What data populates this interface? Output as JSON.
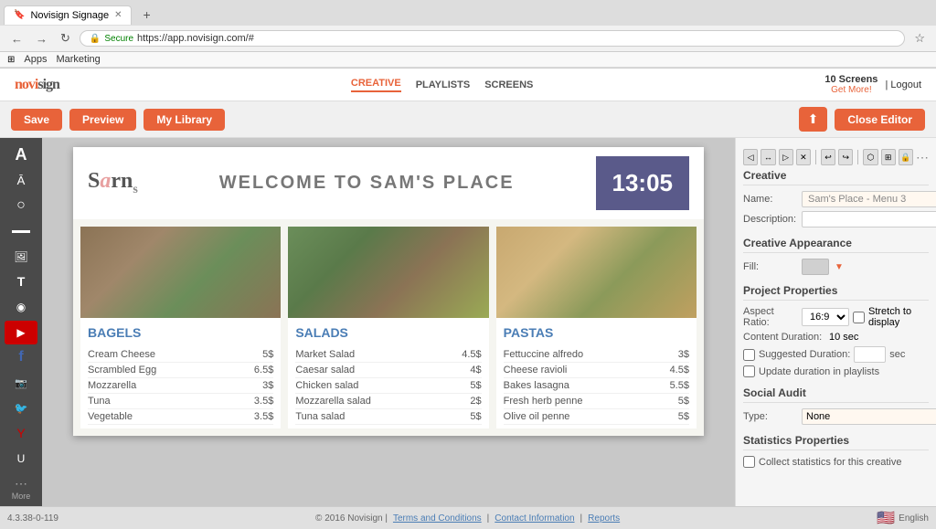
{
  "browser": {
    "tab_title": "Novisign Signage",
    "url": "https://app.novisign.com/#",
    "bookmarks": [
      "Apps",
      "Marketing"
    ]
  },
  "header": {
    "logo": "novi sign",
    "nav": {
      "creative": "CREATIVE",
      "playlists": "PLAYLISTS",
      "screens": "SCREENS"
    },
    "screens_count": "10 Screens",
    "get_more": "Get More!",
    "logout": "| Logout"
  },
  "toolbar": {
    "save": "Save",
    "preview": "Preview",
    "my_library": "My Library",
    "close_editor": "Close Editor"
  },
  "canvas": {
    "sams_logo": "Sams",
    "welcome_text": "WELCOME TO SAM'S PLACE",
    "time": "13:05",
    "sections": [
      {
        "title": "BAGELS",
        "items": [
          {
            "name": "Cream Cheese",
            "price": "5$"
          },
          {
            "name": "Scrambled Egg",
            "price": "6.5$"
          },
          {
            "name": "Mozzarella",
            "price": "3$"
          },
          {
            "name": "Tuna",
            "price": "3.5$"
          },
          {
            "name": "Vegetable",
            "price": "3.5$"
          }
        ]
      },
      {
        "title": "SALADS",
        "items": [
          {
            "name": "Market Salad",
            "price": "4.5$"
          },
          {
            "name": "Caesar salad",
            "price": "4$"
          },
          {
            "name": "Chicken salad",
            "price": "5$"
          },
          {
            "name": "Mozzarella salad",
            "price": "2$"
          },
          {
            "name": "Tuna salad",
            "price": "5$"
          }
        ]
      },
      {
        "title": "PASTAS",
        "items": [
          {
            "name": "Fettuccine alfredo",
            "price": "3$"
          },
          {
            "name": "Cheese ravioli",
            "price": "4.5$"
          },
          {
            "name": "Bakes lasagna",
            "price": "5.5$"
          },
          {
            "name": "Fresh herb penne",
            "price": "5$"
          },
          {
            "name": "Olive oil penne",
            "price": "5$"
          }
        ]
      }
    ]
  },
  "right_panel": {
    "creative_title": "Creative",
    "name_label": "Name:",
    "name_value": "Sam's Place - Menu 3",
    "desc_label": "Description:",
    "desc_value": "",
    "appearance_title": "Creative Appearance",
    "fill_label": "Fill:",
    "project_title": "Project Properties",
    "aspect_label": "Aspect Ratio:",
    "aspect_value": "16:9",
    "stretch_label": "Stretch to display",
    "content_label": "Content Duration:",
    "content_value": "10 sec",
    "suggested_label": "Suggested Duration:",
    "sec_label": "sec",
    "update_label": "Update duration in playlists",
    "social_title": "Social Audit",
    "type_label": "Type:",
    "type_value": "None",
    "stats_title": "Statistics Properties",
    "collect_label": "Collect statistics for this creative"
  },
  "footer": {
    "version": "4.3.38-0-119",
    "copyright": "© 2016 Novisign |",
    "terms": "Terms and Conditions",
    "contact": "Contact Information",
    "reports": "Reports",
    "language": "English"
  },
  "sidebar_tools": [
    {
      "name": "text-tool",
      "icon": "A"
    },
    {
      "name": "text-style-tool",
      "icon": "Ā"
    },
    {
      "name": "circle-tool",
      "icon": "○"
    },
    {
      "name": "video-tool",
      "icon": "▬"
    },
    {
      "name": "image-tool",
      "icon": "🖼"
    },
    {
      "name": "text-box-tool",
      "icon": "T"
    },
    {
      "name": "rss-tool",
      "icon": "◉"
    },
    {
      "name": "youtube-tool",
      "icon": "▶"
    },
    {
      "name": "facebook-tool",
      "icon": "f"
    },
    {
      "name": "instagram-tool",
      "icon": "📷"
    },
    {
      "name": "twitter-tool",
      "icon": "🐦"
    },
    {
      "name": "y-tool",
      "icon": "Y"
    },
    {
      "name": "clock-tool",
      "icon": "U"
    },
    {
      "name": "more-tool",
      "icon": "⋯"
    }
  ],
  "more_label": "More"
}
